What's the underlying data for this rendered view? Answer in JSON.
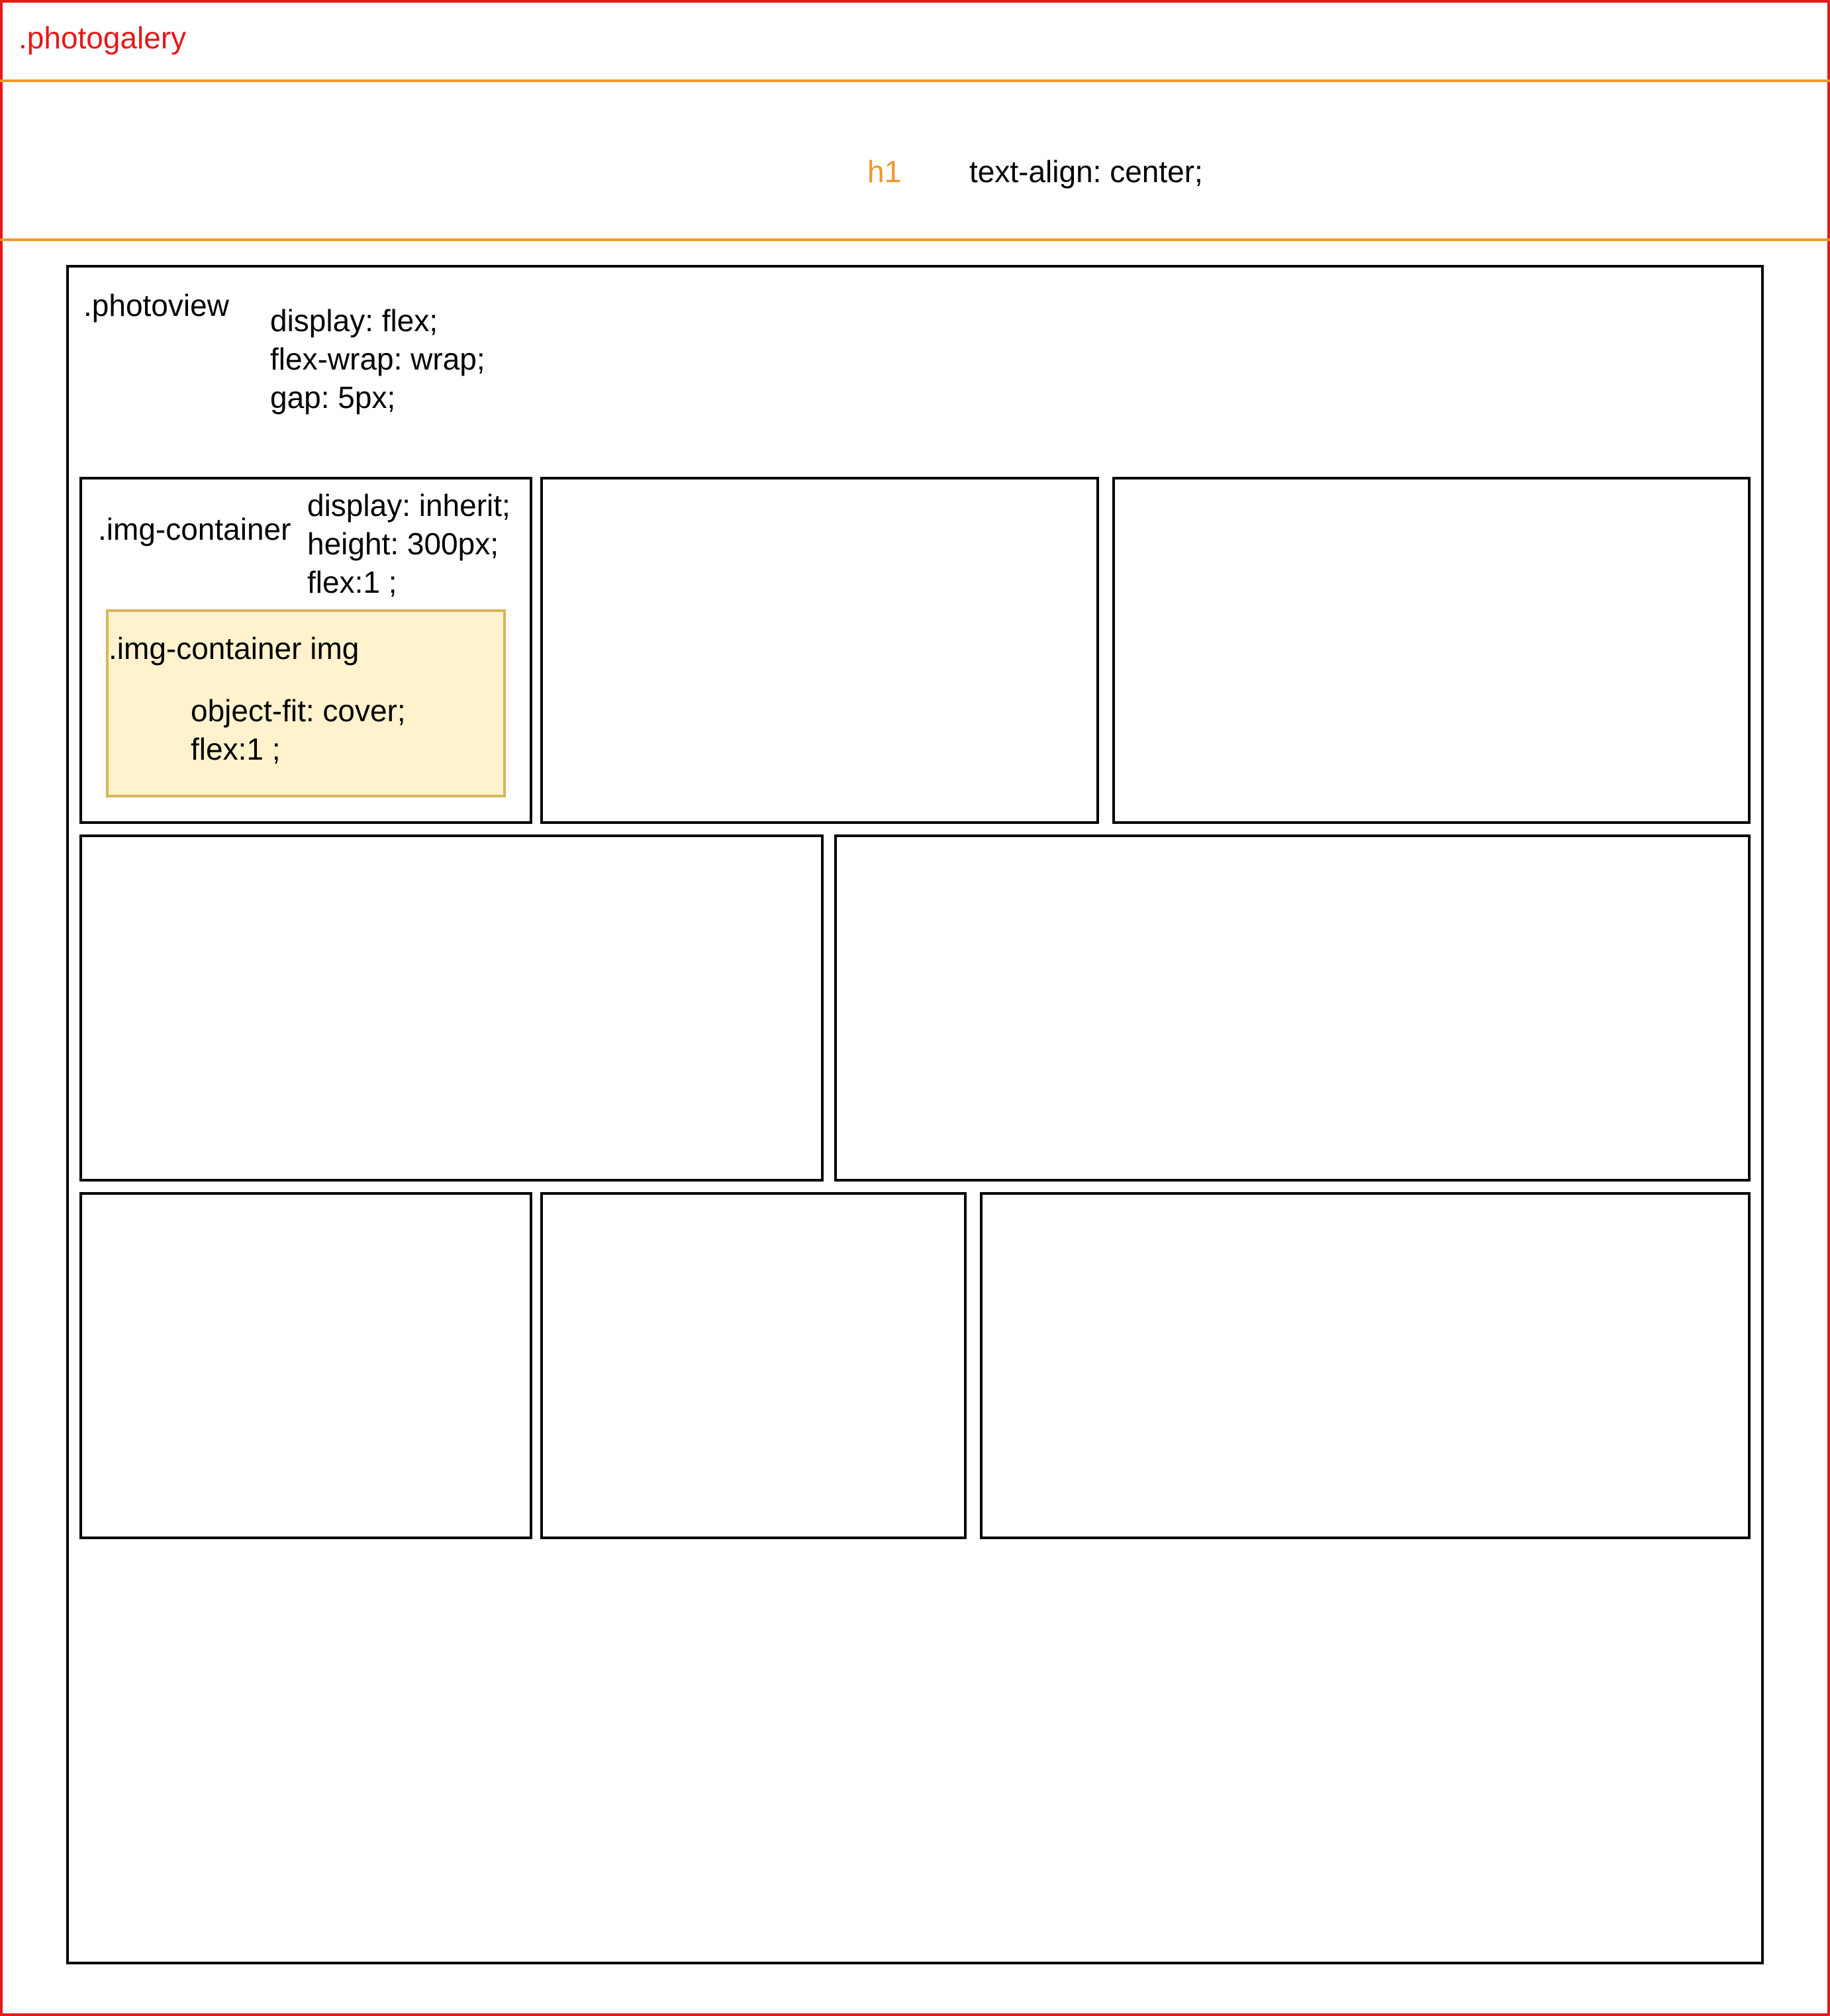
{
  "photogalery": {
    "label": ".photogalery",
    "color": "#e51919"
  },
  "h1": {
    "label": "h1",
    "css": "text-align: center;",
    "color": "#f0962d"
  },
  "photoview": {
    "label": ".photoview",
    "css": [
      "display: flex;",
      "flex-wrap: wrap;",
      "gap: 5px;"
    ]
  },
  "img_container": {
    "label": ".img-container",
    "css": [
      "display: inherit;",
      "height: 300px;",
      "flex:1 ;"
    ]
  },
  "img": {
    "label": ".img-container img",
    "css": [
      "object-fit: cover;",
      "flex:1 ;"
    ],
    "fill": "#fff2cc",
    "border": "#d6b656"
  },
  "colors": {
    "line": "#000000",
    "background": "#ffffff"
  }
}
